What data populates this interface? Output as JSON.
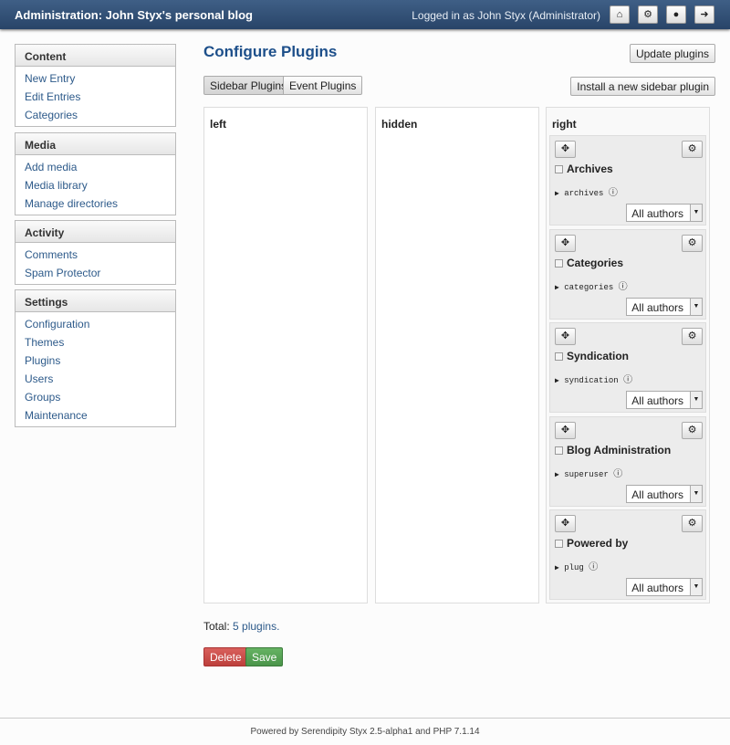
{
  "header": {
    "title": "Administration: John Styx's personal blog",
    "user": "Logged in as John Styx (Administrator)",
    "icons": [
      "home-icon",
      "cogs-icon",
      "globe-icon",
      "logout-icon"
    ]
  },
  "sidebar": [
    {
      "title": "Content",
      "items": [
        "New Entry",
        "Edit Entries",
        "Categories"
      ]
    },
    {
      "title": "Media",
      "items": [
        "Add media",
        "Media library",
        "Manage directories"
      ]
    },
    {
      "title": "Activity",
      "items": [
        "Comments",
        "Spam Protector"
      ]
    },
    {
      "title": "Settings",
      "items": [
        "Configuration",
        "Themes",
        "Plugins",
        "Users",
        "Groups",
        "Maintenance"
      ]
    }
  ],
  "main": {
    "title": "Configure Plugins",
    "update_label": "Update plugins",
    "install_label": "Install a new sidebar plugin",
    "tabs": [
      {
        "label": "Sidebar Plugins",
        "active": true
      },
      {
        "label": "Event Plugins",
        "active": false
      }
    ],
    "columns": [
      "left",
      "hidden",
      "right"
    ],
    "plugins": [
      {
        "name": "Archives",
        "id": "archives",
        "author": "All authors"
      },
      {
        "name": "Categories",
        "id": "categories",
        "author": "All authors"
      },
      {
        "name": "Syndication",
        "id": "syndication",
        "author": "All authors"
      },
      {
        "name": "Blog Administration",
        "id": "superuser",
        "author": "All authors"
      },
      {
        "name": "Powered by",
        "id": "plug",
        "author": "All authors"
      }
    ],
    "total_prefix": "Total:",
    "total": "5 plugins.",
    "delete_label": "Delete",
    "save_label": "Save"
  },
  "footer": "Powered by Serendipity Styx 2.5-alpha1 and PHP 7.1.14"
}
